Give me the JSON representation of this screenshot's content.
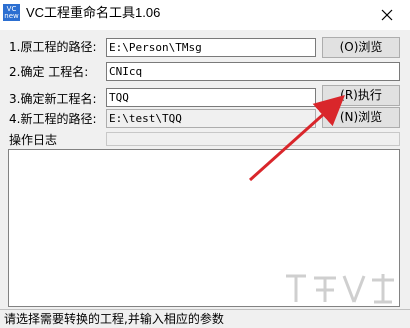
{
  "window": {
    "title": "VC工程重命名工具1.06",
    "icon_text_line1": "VC",
    "icon_text_line2": "new",
    "close_label": "✕"
  },
  "form": {
    "original_path_label": "1.原工程的路径:",
    "original_path_value": "E:\\Person\\TMsg",
    "original_browse_label": "(O)浏览",
    "confirm_label": "2.确定  工程名:",
    "confirm_value": "CNIcq",
    "new_name_label": "3.确定新工程名:",
    "new_name_value": "TQQ",
    "execute_label": "(R)执行",
    "new_path_label": "4.新工程的路径:",
    "new_path_value": "E:\\test\\TQQ",
    "new_browse_label": "(N)浏览"
  },
  "log": {
    "title": "操作日志"
  },
  "status": {
    "text": "请选择需要转换的工程,并输入相应的参数"
  },
  "colors": {
    "arrow": "#d9262b",
    "icon_bg": "#2c6fd1"
  },
  "icons": [
    "app-icon",
    "close-icon",
    "watermark-logo"
  ]
}
